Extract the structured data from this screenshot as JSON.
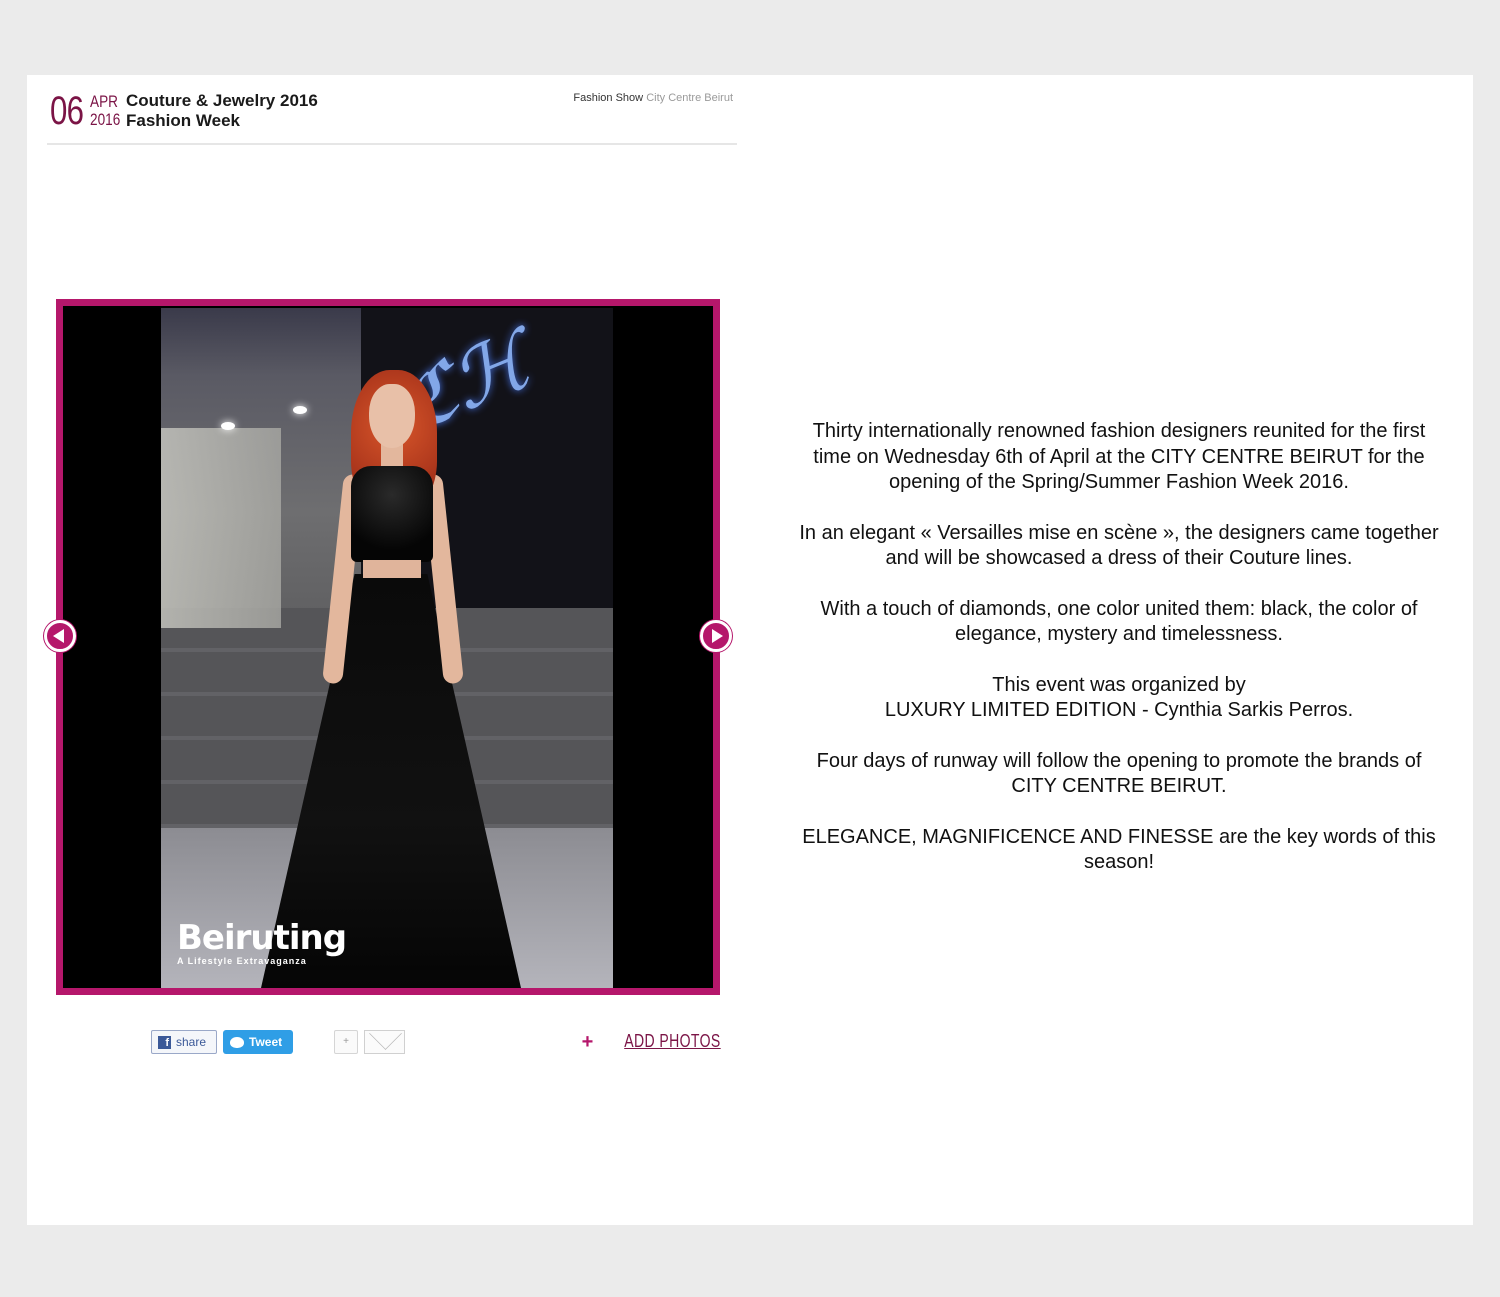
{
  "event": {
    "day": "06",
    "month": "APR",
    "year": "2016",
    "title_line1": "Couture & Jewelry 2016",
    "title_line2": "Fashion Week",
    "breadcrumb_category": "Fashion Show",
    "breadcrumb_venue": "City Centre Beirut"
  },
  "gallery": {
    "watermark_logo": "Beiruting",
    "watermark_tagline": "A Lifestyle Extravaganza",
    "prev_icon": "arrow-left-icon",
    "next_icon": "arrow-right-icon",
    "accent_color": "#b5176b"
  },
  "share": {
    "facebook_label": "share",
    "twitter_label": "Tweet",
    "plus_label": "+",
    "add_photos_plus": "+",
    "add_photos_label": "ADD PHOTOS"
  },
  "article": {
    "paragraphs": [
      [
        "Thirty internationally renowned fashion designers reunited for the first time on Wednesday 6th of April at the CITY CENTRE BEIRUT for the opening of the Spring/Summer Fashion Week 2016."
      ],
      [
        "In an elegant « Versailles mise en scène », the designers came together and will be showcased a dress of their Couture lines."
      ],
      [
        "With a touch of diamonds, one color united them: black, the color of elegance, mystery and timelessness."
      ],
      [
        "This event was organized by",
        "LUXURY LIMITED EDITION - Cynthia Sarkis Perros."
      ],
      [
        "Four days of runway will follow the opening to promote the brands of CITY CENTRE BEIRUT."
      ],
      [
        "ELEGANCE, MAGNIFICENCE AND FINESSE are the key words of this season!"
      ]
    ]
  }
}
